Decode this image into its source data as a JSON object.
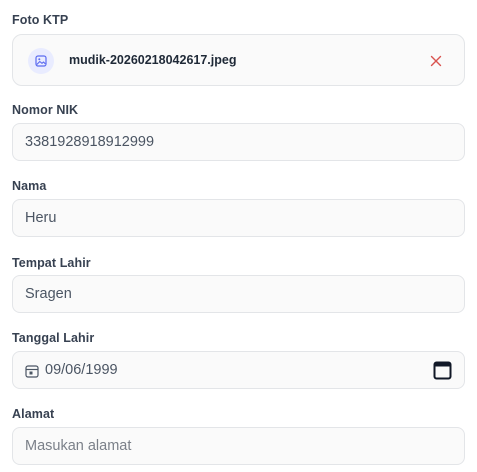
{
  "form": {
    "foto_ktp": {
      "label": "Foto KTP",
      "file_name": "mudik-20260218042617.jpeg",
      "icon": "image-icon",
      "remove_icon": "close-icon"
    },
    "nik": {
      "label": "Nomor NIK",
      "value": "3381928918912999"
    },
    "nama": {
      "label": "Nama",
      "value": "Heru"
    },
    "tempat_lahir": {
      "label": "Tempat Lahir",
      "value": "Sragen"
    },
    "tanggal_lahir": {
      "label": "Tanggal Lahir",
      "value": "09/06/1999",
      "icon": "calendar-icon"
    },
    "alamat": {
      "label": "Alamat",
      "placeholder": "Masukan alamat",
      "value": ""
    }
  },
  "colors": {
    "accent": "#5b6bf0",
    "remove": "#d9534f",
    "border": "#e3e5e8",
    "field_bg": "#fafafa"
  }
}
